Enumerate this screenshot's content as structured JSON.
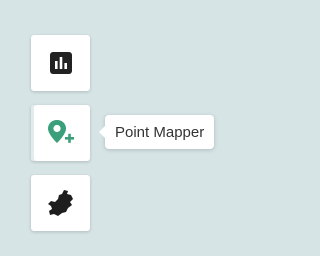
{
  "toolbar": {
    "buttons": [
      {
        "id": "charts",
        "icon": "bar-chart-icon",
        "color": "#222222"
      },
      {
        "id": "point-mapper",
        "icon": "map-pin-add-icon",
        "color": "#3a9f7a",
        "active": true
      },
      {
        "id": "region",
        "icon": "region-map-icon",
        "color": "#222222"
      }
    ]
  },
  "tooltip": {
    "text": "Point Mapper"
  },
  "colors": {
    "background": "#d6e4e6",
    "accent": "#3a9f7a"
  }
}
